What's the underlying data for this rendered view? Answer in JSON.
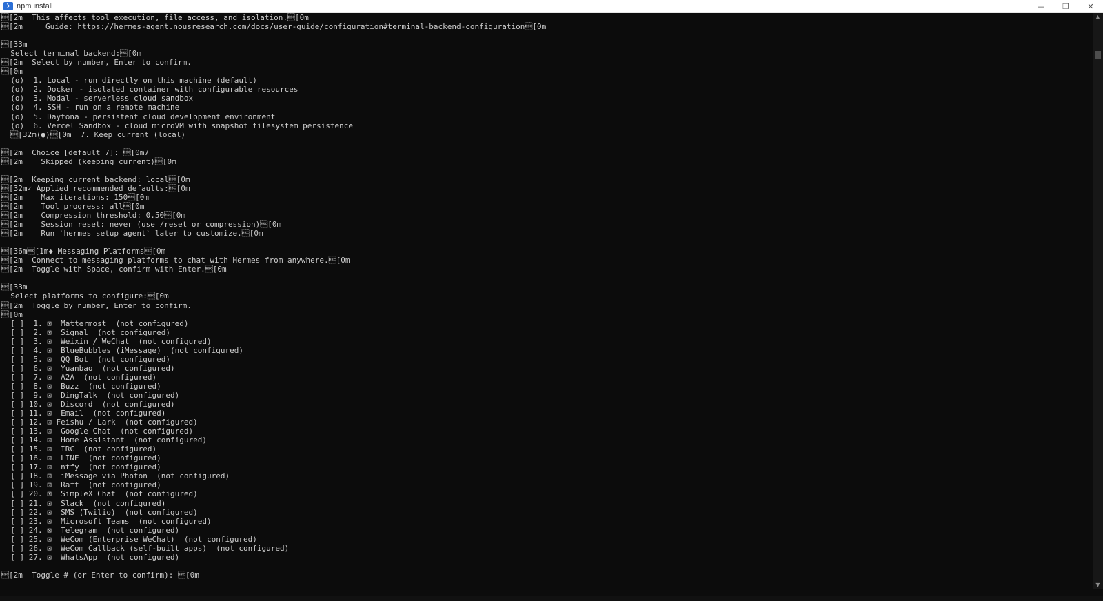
{
  "window": {
    "title": "npm install",
    "icon": "powershell-icon",
    "controls": {
      "minimize": "—",
      "restore": "❐",
      "close": "✕"
    }
  },
  "terminal": {
    "lines": [
      "\u001b[2m  This affects tool execution, file access, and isolation.\u001b[0m",
      "\u001b[2m     Guide: https://hermes-agent.nousresearch.com/docs/user-guide/configuration#terminal-backend-configuration\u001b[0m",
      "",
      "\u001b[33m",
      "  Select terminal backend:\u001b[0m",
      "\u001b[2m  Select by number, Enter to confirm.",
      "\u001b[0m",
      "  (o)  1. Local - run directly on this machine (default)",
      "  (o)  2. Docker - isolated container with configurable resources",
      "  (o)  3. Modal - serverless cloud sandbox",
      "  (o)  4. SSH - run on a remote machine",
      "  (o)  5. Daytona - persistent cloud development environment",
      "  (o)  6. Vercel Sandbox - cloud microVM with snapshot filesystem persistence",
      "  \u001b[32m(●)\u001b[0m  7. Keep current (local)",
      "",
      "\u001b[2m  Choice [default 7]: \u001b[0m7",
      "\u001b[2m    Skipped (keeping current)\u001b[0m",
      "",
      "\u001b[2m  Keeping current backend: local\u001b[0m",
      "\u001b[32m✓ Applied recommended defaults:\u001b[0m",
      "\u001b[2m    Max iterations: 150\u001b[0m",
      "\u001b[2m    Tool progress: all\u001b[0m",
      "\u001b[2m    Compression threshold: 0.50\u001b[0m",
      "\u001b[2m    Session reset: never (use /reset or compression)\u001b[0m",
      "\u001b[2m    Run `hermes setup agent` later to customize.\u001b[0m",
      "",
      "\u001b[36m\u001b[1m◆ Messaging Platforms\u001b[0m",
      "\u001b[2m  Connect to messaging platforms to chat with Hermes from anywhere.\u001b[0m",
      "\u001b[2m  Toggle with Space, confirm with Enter.\u001b[0m",
      "",
      "\u001b[33m",
      "  Select platforms to configure:\u001b[0m",
      "\u001b[2m  Toggle by number, Enter to confirm.",
      "\u001b[0m",
      "  [ ]  1. ⊡  Mattermost  (not configured)",
      "  [ ]  2. ⊡  Signal  (not configured)",
      "  [ ]  3. ⊡  Weixin / WeChat  (not configured)",
      "  [ ]  4. ⊡  BlueBubbles (iMessage)  (not configured)",
      "  [ ]  5. ⊡  QQ Bot  (not configured)",
      "  [ ]  6. ⊡  Yuanbao  (not configured)",
      "  [ ]  7. ⊡  A2A  (not configured)",
      "  [ ]  8. ⊡  Buzz  (not configured)",
      "  [ ]  9. ⊡  DingTalk  (not configured)",
      "  [ ] 10. ⊡  Discord  (not configured)",
      "  [ ] 11. ⊡  Email  (not configured)",
      "  [ ] 12. ⊡ Feishu / Lark  (not configured)",
      "  [ ] 13. ⊡  Google Chat  (not configured)",
      "  [ ] 14. ⊡  Home Assistant  (not configured)",
      "  [ ] 15. ⊡  IRC  (not configured)",
      "  [ ] 16. ⊡  LINE  (not configured)",
      "  [ ] 17. ⊡  ntfy  (not configured)",
      "  [ ] 18. ⊡  iMessage via Photon  (not configured)",
      "  [ ] 19. ⊡  Raft  (not configured)",
      "  [ ] 20. ⊡  SimpleX Chat  (not configured)",
      "  [ ] 21. ⊡  Slack  (not configured)",
      "  [ ] 22. ⊡  SMS (Twilio)  (not configured)",
      "  [ ] 23. ⊡  Microsoft Teams  (not configured)",
      "  [ ] 24. ⊠  Telegram  (not configured)",
      "  [ ] 25. ⊡  WeCom (Enterprise WeChat)  (not configured)",
      "  [ ] 26. ⊡  WeCom Callback (self-built apps)  (not configured)",
      "  [ ] 27. ⊡  WhatsApp  (not configured)",
      "",
      "\u001b[2m  Toggle # (or Enter to confirm): \u001b[0m"
    ]
  }
}
